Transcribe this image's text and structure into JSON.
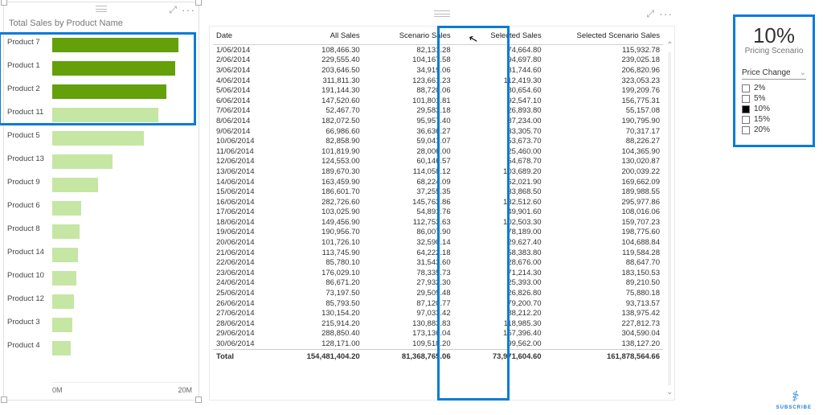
{
  "chart_data": {
    "type": "bar",
    "title": "Total Sales by Product Name",
    "xlabel": "",
    "ylabel": "",
    "xlim": [
      0,
      25000000
    ],
    "ticks": [
      "0M",
      "20M"
    ],
    "categories": [
      "Product 7",
      "Product 1",
      "Product 2",
      "Product 11",
      "Product 5",
      "Product 13",
      "Product 9",
      "Product 6",
      "Product 8",
      "Product 14",
      "Product 10",
      "Product 12",
      "Product 3",
      "Product 4"
    ],
    "values": [
      22000000,
      21500000,
      20000000,
      18500000,
      16000000,
      10500000,
      8000000,
      5000000,
      4800000,
      4500000,
      4200000,
      3800000,
      3500000,
      3200000
    ],
    "selected": [
      true,
      true,
      true,
      false,
      false,
      false,
      false,
      false,
      false,
      false,
      false,
      false,
      false,
      false
    ]
  },
  "table": {
    "columns": [
      "Date",
      "All Sales",
      "Scenario Sales",
      "Selected Sales",
      "Selected Scenario Sales"
    ],
    "rows": [
      [
        "1/06/2014",
        "108,466.30",
        "82,131.28",
        "74,664.80",
        "115,932.78"
      ],
      [
        "2/06/2014",
        "229,555.40",
        "104,167.58",
        "94,697.80",
        "239,025.18"
      ],
      [
        "3/06/2014",
        "203,646.50",
        "34,919.06",
        "31,744.60",
        "206,820.96"
      ],
      [
        "4/06/2014",
        "311,811.30",
        "123,661.23",
        "112,419.30",
        "323,053.23"
      ],
      [
        "5/06/2014",
        "191,144.30",
        "88,720.06",
        "80,654.60",
        "199,209.76"
      ],
      [
        "6/06/2014",
        "147,520.60",
        "101,801.81",
        "92,547.10",
        "156,775.31"
      ],
      [
        "7/06/2014",
        "52,467.70",
        "29,583.18",
        "26,893.80",
        "55,157.08"
      ],
      [
        "8/06/2014",
        "182,072.50",
        "95,957.40",
        "87,234.00",
        "190,795.90"
      ],
      [
        "9/06/2014",
        "66,986.60",
        "36,636.27",
        "33,305.70",
        "70,317.17"
      ],
      [
        "10/06/2014",
        "82,858.90",
        "59,041.07",
        "53,673.70",
        "88,226.27"
      ],
      [
        "11/06/2014",
        "101,819.90",
        "28,006.00",
        "25,460.00",
        "104,365.90"
      ],
      [
        "12/06/2014",
        "124,553.00",
        "60,146.57",
        "54,678.70",
        "130,020.87"
      ],
      [
        "13/06/2014",
        "189,670.30",
        "114,058.12",
        "103,689.20",
        "200,039.22"
      ],
      [
        "14/06/2014",
        "163,459.90",
        "68,224.09",
        "62,021.90",
        "169,662.09"
      ],
      [
        "15/06/2014",
        "186,601.70",
        "37,255.35",
        "33,868.50",
        "189,988.55"
      ],
      [
        "16/06/2014",
        "282,726.60",
        "145,763.86",
        "132,512.60",
        "295,977.86"
      ],
      [
        "17/06/2014",
        "103,025.90",
        "54,891.76",
        "49,901.60",
        "108,016.06"
      ],
      [
        "18/06/2014",
        "149,456.90",
        "112,753.63",
        "102,503.30",
        "159,707.23"
      ],
      [
        "19/06/2014",
        "190,956.70",
        "86,007.90",
        "78,189.00",
        "198,775.60"
      ],
      [
        "20/06/2014",
        "101,726.10",
        "32,590.14",
        "29,627.40",
        "104,688.84"
      ],
      [
        "21/06/2014",
        "113,745.90",
        "64,222.18",
        "58,383.80",
        "119,584.28"
      ],
      [
        "22/06/2014",
        "85,780.10",
        "31,543.60",
        "28,676.00",
        "88,647.70"
      ],
      [
        "23/06/2014",
        "176,029.10",
        "78,335.73",
        "71,214.30",
        "183,150.53"
      ],
      [
        "24/06/2014",
        "86,671.20",
        "27,932.30",
        "25,393.00",
        "89,210.50"
      ],
      [
        "25/06/2014",
        "73,197.50",
        "29,509.48",
        "26,826.80",
        "75,880.18"
      ],
      [
        "26/06/2014",
        "85,793.50",
        "87,120.77",
        "79,200.70",
        "93,713.57"
      ],
      [
        "27/06/2014",
        "130,154.20",
        "97,033.42",
        "88,212.20",
        "138,975.42"
      ],
      [
        "28/06/2014",
        "215,914.20",
        "130,883.83",
        "118,985.30",
        "227,812.73"
      ],
      [
        "29/06/2014",
        "288,850.40",
        "173,136.04",
        "157,396.40",
        "304,590.04"
      ],
      [
        "30/06/2014",
        "128,171.00",
        "109,518.20",
        "99,562.00",
        "138,127.20"
      ]
    ],
    "total": [
      "Total",
      "154,481,404.20",
      "81,368,765.06",
      "73,971,604.60",
      "161,878,564.66"
    ]
  },
  "card": {
    "value": "10%",
    "label": "Pricing Scenario"
  },
  "slicer": {
    "title": "Price Change",
    "options": [
      {
        "label": "2%",
        "checked": false
      },
      {
        "label": "5%",
        "checked": false
      },
      {
        "label": "10%",
        "checked": true
      },
      {
        "label": "15%",
        "checked": false
      },
      {
        "label": "20%",
        "checked": false
      }
    ]
  },
  "subscribe": "SUBSCRIBE"
}
